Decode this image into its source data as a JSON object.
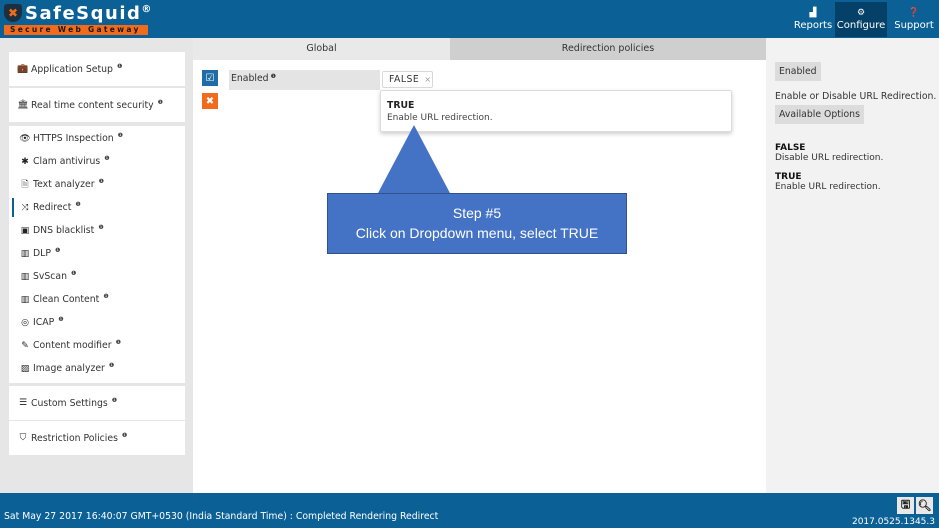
{
  "header": {
    "brand": "SafeSquid",
    "brand_mark": "®",
    "tagline": "Secure Web Gateway",
    "nav": [
      {
        "label": "Reports",
        "icon": "chart-area-icon",
        "active": false
      },
      {
        "label": "Configure",
        "icon": "cogs-icon",
        "active": true
      },
      {
        "label": "Support",
        "icon": "question-circle-icon",
        "active": false
      }
    ]
  },
  "sidebar": {
    "groups": [
      {
        "items": [
          {
            "label": "Application Setup",
            "icon": "briefcase-icon"
          }
        ]
      },
      {
        "items": [
          {
            "label": "Real time content security",
            "icon": "bank-icon"
          }
        ]
      },
      {
        "items": [
          {
            "label": "HTTPS Inspection",
            "icon": "eye-icon"
          },
          {
            "label": "Clam antivirus",
            "icon": "asterisk-icon"
          },
          {
            "label": "Text analyzer",
            "icon": "file-text-icon"
          },
          {
            "label": "Redirect",
            "icon": "random-icon",
            "active": true
          },
          {
            "label": "DNS blacklist",
            "icon": "dns-icon"
          },
          {
            "label": "DLP",
            "icon": "barcode-icon"
          },
          {
            "label": "SvScan",
            "icon": "barcode-icon"
          },
          {
            "label": "Clean Content",
            "icon": "barcode-icon"
          },
          {
            "label": "ICAP",
            "icon": "globe-icon"
          },
          {
            "label": "Content modifier",
            "icon": "edit-icon"
          },
          {
            "label": "Image analyzer",
            "icon": "image-icon"
          }
        ]
      },
      {
        "items": [
          {
            "label": "Custom Settings",
            "icon": "sliders-icon"
          }
        ]
      },
      {
        "items": [
          {
            "label": "Restriction Policies",
            "icon": "shield-icon"
          }
        ]
      }
    ]
  },
  "main": {
    "tabs": [
      {
        "label": "Global",
        "active": true
      },
      {
        "label": "Redirection policies",
        "active": false
      }
    ],
    "field": {
      "label": "Enabled",
      "value": "FALSE",
      "clear_symbol": "×"
    },
    "dropdown_options": [
      {
        "title": "TRUE",
        "description": "Enable URL redirection."
      }
    ]
  },
  "callout": {
    "line1": "Step #5",
    "line2": "Click on Dropdown menu, select TRUE"
  },
  "right_panel": {
    "field_chip": "Enabled",
    "description": "Enable or Disable URL Redirection.",
    "options_chip": "Available Options",
    "options": [
      {
        "title": "FALSE",
        "description": "Disable URL redirection."
      },
      {
        "title": "TRUE",
        "description": "Enable URL redirection."
      }
    ]
  },
  "footer": {
    "status": "Sat May 27 2017 16:40:07 GMT+0530 (India Standard Time) : Completed Rendering Redirect",
    "version": "2017.0525.1345.3"
  },
  "colors": {
    "brand_blue": "#0b6096",
    "accent_orange": "#f26b1d",
    "callout_blue": "#4472c4"
  }
}
